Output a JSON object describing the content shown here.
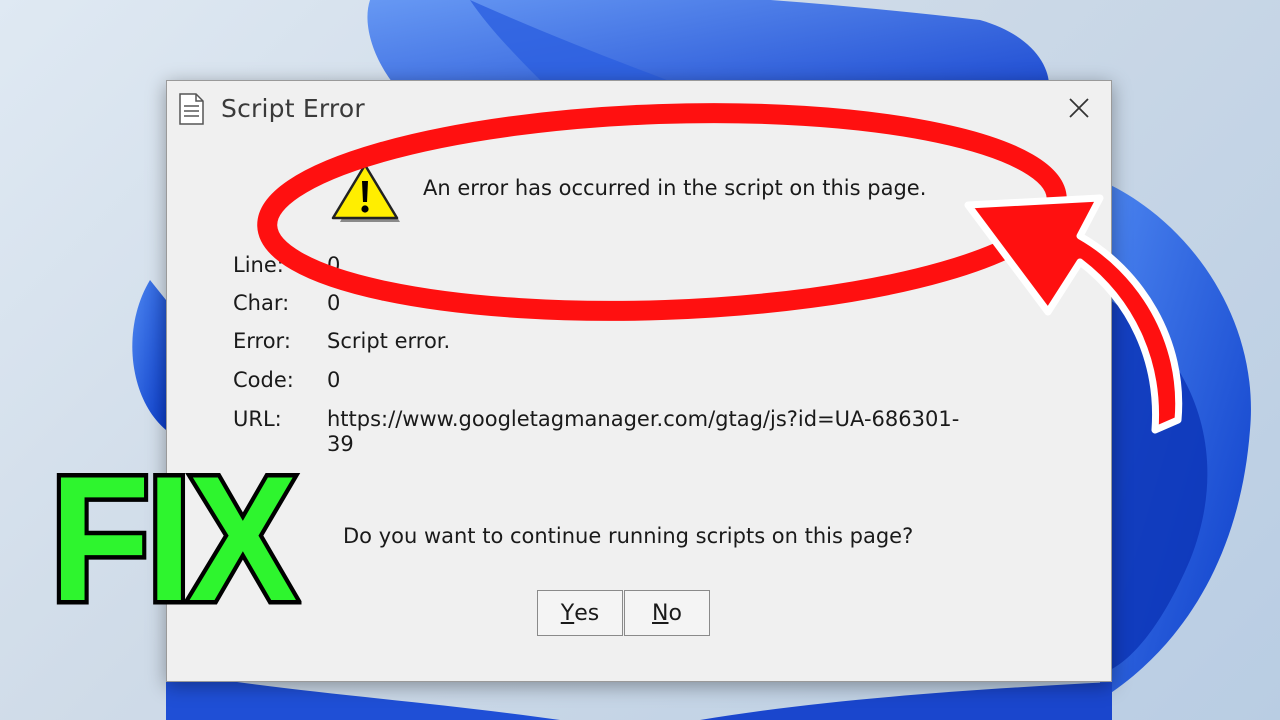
{
  "dialog": {
    "title": "Script Error",
    "message": "An error has occurred in the script on this page.",
    "details": {
      "line_label": "Line:",
      "line_value": "0",
      "char_label": "Char:",
      "char_value": "0",
      "error_label": "Error:",
      "error_value": "Script error.",
      "code_label": "Code:",
      "code_value": "0",
      "url_label": "URL:",
      "url_value": "https://www.googletagmanager.com/gtag/js?id=UA-686301-39"
    },
    "question": "Do you want to continue running scripts on this page?",
    "buttons": {
      "yes_accel": "Y",
      "yes_rest": "es",
      "no_accel": "N",
      "no_rest": "o"
    },
    "icons": {
      "title": "document-icon",
      "warning": "warning-icon",
      "close": "close-icon"
    }
  },
  "overlay": {
    "fix_text": "FIX",
    "colors": {
      "highlight": "#ff1010",
      "fix": "#2ef52e",
      "wallpaper_accent": "#1a4fd8"
    }
  }
}
